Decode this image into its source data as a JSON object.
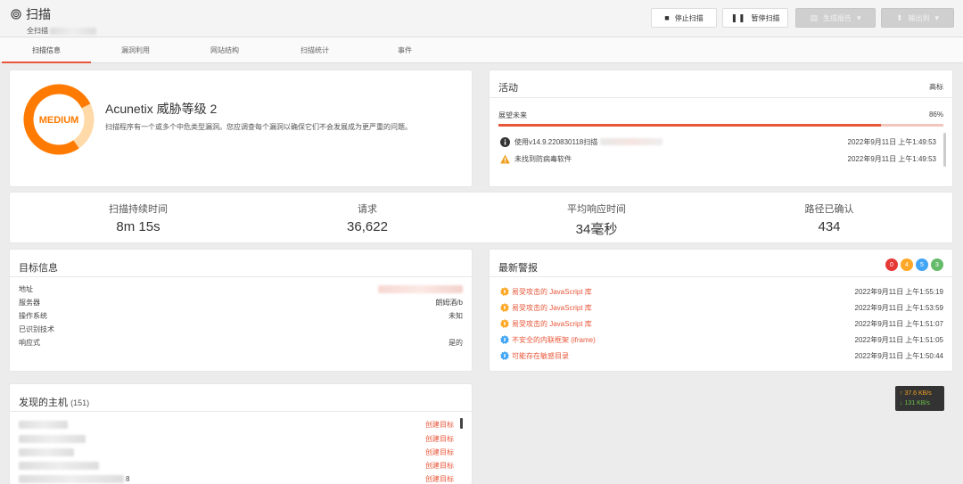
{
  "header": {
    "title": "扫描",
    "subtitle": "全扫描",
    "buttons": {
      "stop": "停止扫描",
      "pause": "暂停扫描",
      "report": "生成报告",
      "export": "输出到"
    }
  },
  "tabs": [
    {
      "label": "扫描信息",
      "active": true
    },
    {
      "label": "漏洞利用",
      "active": false
    },
    {
      "label": "网站结构",
      "active": false
    },
    {
      "label": "扫描统计",
      "active": false
    },
    {
      "label": "事件",
      "active": false
    }
  ],
  "threat": {
    "badge": "MEDIUM",
    "title": "Acunetix 威胁等级 2",
    "description": "扫描程序有一个或多个中危类型漏洞。您应调查每个漏洞以确保它们不会发展成为更严重的问题。",
    "colors": {
      "ring": "#ff7a00",
      "ring_light": "#ffd9a8",
      "text": "#ff7a00"
    }
  },
  "activity": {
    "title": "活动",
    "link": "高标",
    "progress_label": "展望未来",
    "progress_text": "86%",
    "progress_value": 0.86,
    "rows": [
      {
        "icon": "info-icon",
        "text": "使用v14.9.220830118扫描",
        "time": "2022年9月11日 上午1:49:53"
      },
      {
        "icon": "warning-icon",
        "text": "未找到防病毒软件",
        "time": "2022年9月11日 上午1:49:53"
      }
    ]
  },
  "stats": [
    {
      "label": "扫描持续时间",
      "value": "8m 15s"
    },
    {
      "label": "请求",
      "value": "36,622"
    },
    {
      "label": "平均响应时间",
      "value": "34毫秒"
    },
    {
      "label": "路径已确认",
      "value": "434"
    }
  ],
  "target": {
    "title": "目标信息",
    "rows": [
      {
        "key": "地址",
        "value": ""
      },
      {
        "key": "服务器",
        "value": "朗姆酒/b"
      },
      {
        "key": "操作系统",
        "value": "未知"
      },
      {
        "key": "已识别技术",
        "value": ""
      },
      {
        "key": "响应式",
        "value": "是的"
      }
    ]
  },
  "alerts": {
    "title": "最新警报",
    "counts": [
      {
        "value": "0",
        "color": "#e53935"
      },
      {
        "value": "4",
        "color": "#ffa726"
      },
      {
        "value": "5",
        "color": "#42a5f5"
      },
      {
        "value": "3",
        "color": "#66bb6a"
      }
    ],
    "rows": [
      {
        "icon": "bug-orange-icon",
        "name": "易受攻击的 JavaScript 库",
        "time": "2022年9月11日 上午1:55:19"
      },
      {
        "icon": "bug-orange-icon",
        "name": "易受攻击的 JavaScript 库",
        "time": "2022年9月11日 上午1:53:59"
      },
      {
        "icon": "bug-orange-icon",
        "name": "易受攻击的 JavaScript 库",
        "time": "2022年9月11日 上午1:51:07"
      },
      {
        "icon": "bug-blue-icon",
        "name": "不安全的内联框架 (iframe)",
        "time": "2022年9月11日 上午1:51:05"
      },
      {
        "icon": "bug-blue-icon",
        "name": "可能存在敏感目录",
        "time": "2022年9月11日 上午1:50:44"
      }
    ]
  },
  "hosts": {
    "title": "发现的主机",
    "count": "(151)",
    "link_label": "创建目标",
    "last_suffix": "8"
  },
  "speed": {
    "up": "↑ 37.6 KB/s",
    "down": "↓ 131 KB/s"
  }
}
